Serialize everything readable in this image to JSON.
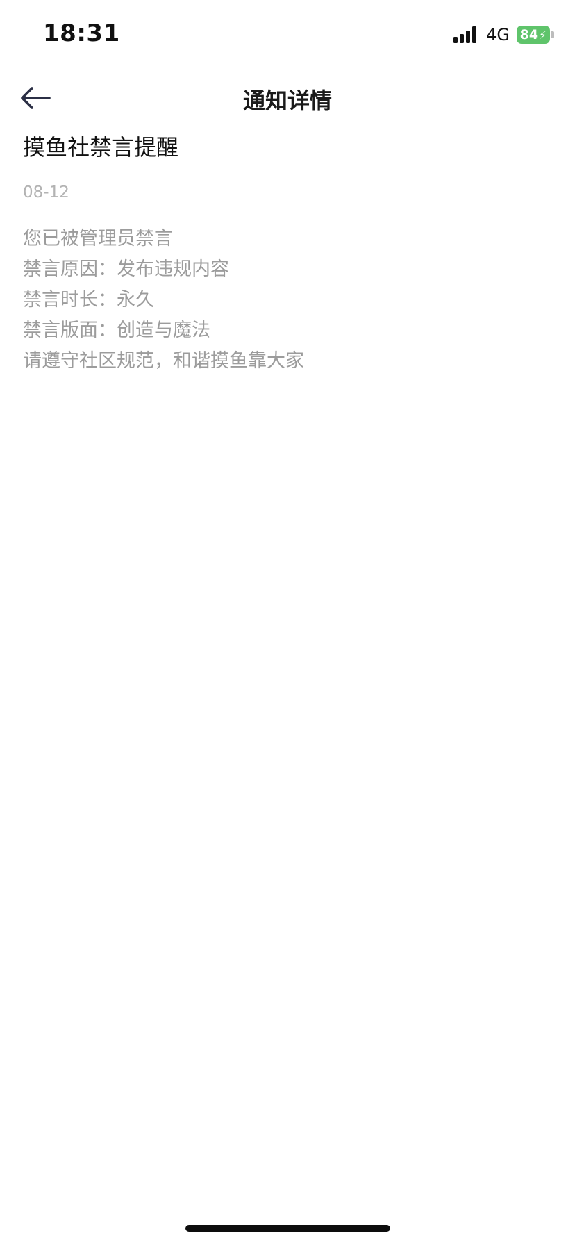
{
  "status_bar": {
    "time": "18:31",
    "network": "4G",
    "battery_level": "84",
    "battery_color": "#5fc46b"
  },
  "nav": {
    "title": "通知详情",
    "back_icon": "arrow-left-icon"
  },
  "notice": {
    "title": "摸鱼社禁言提醒",
    "date": "08-12",
    "lines": [
      "您已被管理员禁言",
      "禁言原因：发布违规内容",
      "禁言时长：永久",
      "禁言版面：创造与魔法",
      "请遵守社区规范，和谐摸鱼靠大家"
    ]
  }
}
